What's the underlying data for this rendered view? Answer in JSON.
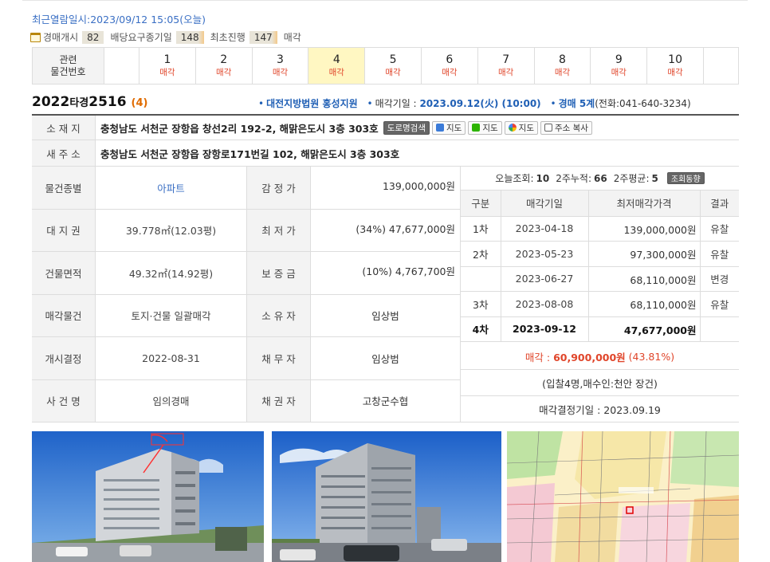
{
  "header": {
    "last_view": "최근열람일시:2023/09/12 15:05(오늘)",
    "counts": [
      {
        "label": "경매개시",
        "value": "82"
      },
      {
        "label": "배당요구종기일",
        "value": "148"
      },
      {
        "label": "최초진행",
        "value": "147"
      },
      {
        "label": "매각",
        "value": ""
      }
    ]
  },
  "related": {
    "head_label": "관련\n물건번호",
    "items": [
      {
        "num": "1",
        "status": "매각"
      },
      {
        "num": "2",
        "status": "매각"
      },
      {
        "num": "3",
        "status": "매각"
      },
      {
        "num": "4",
        "status": "매각"
      },
      {
        "num": "5",
        "status": "매각"
      },
      {
        "num": "6",
        "status": "매각"
      },
      {
        "num": "7",
        "status": "매각"
      },
      {
        "num": "8",
        "status": "매각"
      },
      {
        "num": "9",
        "status": "매각"
      },
      {
        "num": "10",
        "status": "매각"
      }
    ],
    "selected_index": 3
  },
  "case": {
    "year": "2022",
    "type": "타경",
    "number": "2516",
    "item": "(4)",
    "court": "대전지방법원 홍성지원",
    "sale_date_label": "매각기일 :",
    "sale_date": "2023.09.12(火) (10:00)",
    "dept": "경매 5계",
    "phone": "(전화:041-640-3234)"
  },
  "address": {
    "loc_label": "소 재 지",
    "loc_value": "충청남도 서천군 장항읍 창선2리 192-2, 해맑은도시 3층 303호",
    "road_btn": "도로명검색",
    "map_btns": [
      "지도",
      "지도",
      "지도"
    ],
    "copy_btn": "주소 복사",
    "new_label": "새 주 소",
    "new_value": "충청남도 서천군 장항읍 장항로171번길 102, 해맑은도시 3층 303호"
  },
  "details": [
    {
      "l1": "물건종별",
      "v1": "아파트",
      "l2": "감 정 가",
      "v2": "139,000,000원"
    },
    {
      "l1": "대 지 권",
      "v1": "39.778㎡(12.03평)",
      "l2": "최 저 가",
      "v2": "(34%) 47,677,000원"
    },
    {
      "l1": "건물면적",
      "v1": "49.32㎡(14.92평)",
      "l2": "보 증 금",
      "v2": "(10%) 4,767,700원"
    },
    {
      "l1": "매각물건",
      "v1": "토지·건물 일괄매각",
      "l2": "소 유 자",
      "v2": "임상범"
    },
    {
      "l1": "개시결정",
      "v1": "2022-08-31",
      "l2": "채 무 자",
      "v2": "임상범"
    },
    {
      "l1": "사 건 명",
      "v1": "임의경매",
      "l2": "채 권 자",
      "v2": "고창군수협"
    }
  ],
  "views": {
    "today_label": "오늘조회:",
    "today": "10",
    "two_week_label": "2주누적:",
    "two_week": "66",
    "avg_label": "2주평균:",
    "avg": "5",
    "button": "조회동향"
  },
  "bids": {
    "headers": [
      "구분",
      "매각기일",
      "최저매각가격",
      "결과"
    ],
    "rows": [
      {
        "round": "1차",
        "date": "2023-04-18",
        "price": "139,000,000원",
        "result": "유찰"
      },
      {
        "round": "2차",
        "date": "2023-05-23",
        "price": "97,300,000원",
        "result": "유찰"
      },
      {
        "round": "",
        "date": "2023-06-27",
        "price": "68,110,000원",
        "result": "변경"
      },
      {
        "round": "3차",
        "date": "2023-08-08",
        "price": "68,110,000원",
        "result": "유찰"
      },
      {
        "round": "4차",
        "date": "2023-09-12",
        "price": "47,677,000원",
        "result": ""
      }
    ],
    "sold_label": "매각 :",
    "sold_price": "60,900,000원",
    "sold_rate": "(43.81%)",
    "bid_info": "(입찰4명,매수인:천안 장건)",
    "decision": "매각결정기일 : 2023.09.19"
  },
  "photos": [
    {
      "name": "building-photo-1"
    },
    {
      "name": "building-photo-2"
    },
    {
      "name": "cadastral-map"
    }
  ]
}
